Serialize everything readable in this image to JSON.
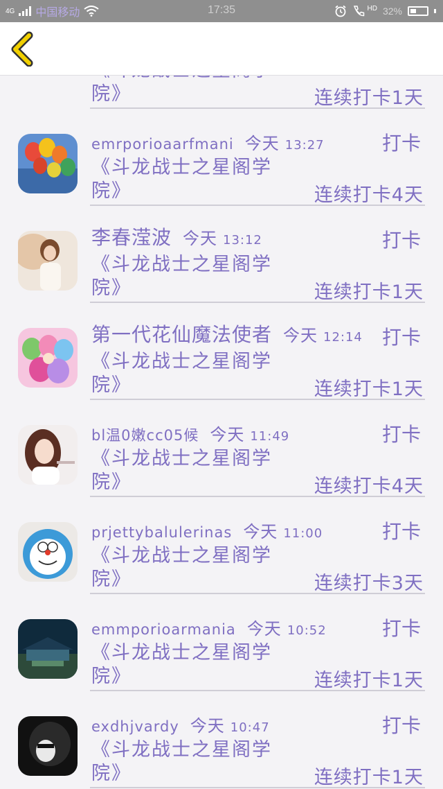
{
  "status_bar": {
    "network": "4G",
    "carrier": "中国移动",
    "time": "17:35",
    "hd": "HD",
    "battery": "32%"
  },
  "colors": {
    "accent": "#7f6fc2",
    "back_arrow": "#f1d000"
  },
  "checkins": [
    {
      "username": "",
      "time_word": "",
      "time": "",
      "action": "",
      "title": "《斗龙战士之星阁学院》",
      "streak": "连续打卡1天",
      "avatar": "partial"
    },
    {
      "username": "emrporioaarfmani",
      "time_word": "今天",
      "time": "13:27",
      "action": "打卡",
      "title": "《斗龙战士之星阁学院》",
      "streak": "连续打卡4天",
      "avatar": "balloons"
    },
    {
      "username": "李春滢波",
      "time_word": "今天",
      "time": "13:12",
      "action": "打卡",
      "title": "《斗龙战士之星阁学院》",
      "streak": "连续打卡1天",
      "avatar": "girl-umbrella"
    },
    {
      "username": "第一代花仙魔法使者",
      "time_word": "今天",
      "time": "12:14",
      "action": "打卡",
      "title": "《斗龙战士之星阁学院》",
      "streak": "连续打卡1天",
      "avatar": "anime-fairies"
    },
    {
      "username": "bl温0嫩cc05候",
      "time_word": "今天",
      "time": "11:49",
      "action": "打卡",
      "title": "《斗龙战士之星阁学院》",
      "streak": "连续打卡4天",
      "avatar": "girl-portrait"
    },
    {
      "username": "prjettybalulerinas",
      "time_word": "今天",
      "time": "11:00",
      "action": "打卡",
      "title": "《斗龙战士之星阁学院》",
      "streak": "连续打卡3天",
      "avatar": "doraemon-clock"
    },
    {
      "username": "emmporioarmania",
      "time_word": "今天",
      "time": "10:52",
      "action": "打卡",
      "title": "《斗龙战士之星阁学院》",
      "streak": "连续打卡1天",
      "avatar": "night-house"
    },
    {
      "username": "exdhjvardy",
      "time_word": "今天",
      "time": "10:47",
      "action": "打卡",
      "title": "《斗龙战士之星阁学院》",
      "streak": "连续打卡1天",
      "avatar": "dark-portrait"
    }
  ]
}
